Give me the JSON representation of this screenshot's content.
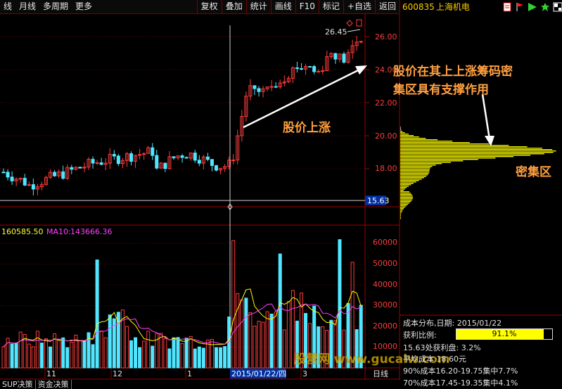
{
  "toolbar": {
    "left_items": [
      "线",
      "月线",
      "多周期",
      "更多"
    ],
    "right_items": [
      "复权",
      "叠加",
      "统计",
      "画线",
      "F10",
      "标记",
      "+自选",
      "返回"
    ]
  },
  "stock": {
    "code": "600835",
    "name": "上海机电"
  },
  "price_axis": {
    "ticks": [
      "26.00",
      "24.00",
      "22.00",
      "20.00",
      "18.00"
    ],
    "current_price": "15.63",
    "high_label": "26.45"
  },
  "volume_axis": {
    "ticks": [
      "60000",
      "50000",
      "40000",
      "30000",
      "20000",
      "10000"
    ]
  },
  "volume_legend": {
    "vol_text": "160585.50",
    "ma10_label": "MA10:",
    "ma10_value": "143666.36"
  },
  "time_axis": {
    "labels": [
      "11",
      "12",
      "1",
      "3"
    ],
    "cursor_date": "2015/01/22/四",
    "period_label": "日线"
  },
  "cost_panel": {
    "title": "成本分布,日期: 2015/01/22",
    "profit_label": "获利比例:",
    "profit_value": "91.1%",
    "profit_ratio": 0.911,
    "line1": "15.63处获利盘: 3.2%",
    "line2": "平均成本 18.60元",
    "line3": "90%成本16.20-19.75集中7.7%",
    "line4": "70%成本17.45-19.35集中4.1%"
  },
  "bottom_tabs": [
    "SUP决策",
    "资金决策"
  ],
  "annotations": {
    "rise_label": "股价上涨",
    "support_line1": "股价在其上上涨筹码密",
    "support_line2": "集区具有支撑作用",
    "dense_label": "密集区"
  },
  "watermark": "股营网 www.gucaiw.com",
  "colors": {
    "up": "#ff3c3c",
    "down": "#50e6ff",
    "ma": "#ffff00",
    "ma10": "#ff40ff",
    "chip": "#ffff00",
    "border": "#a00000",
    "annotation": "#ffa040"
  },
  "chart_data": {
    "type": "candlestick",
    "visible_values": {
      "high": 26.45,
      "current": 15.63
    },
    "volume_ticks": [
      10000,
      20000,
      30000,
      40000,
      50000,
      60000
    ],
    "price_ticks": [
      18,
      20,
      22,
      24,
      26
    ]
  }
}
